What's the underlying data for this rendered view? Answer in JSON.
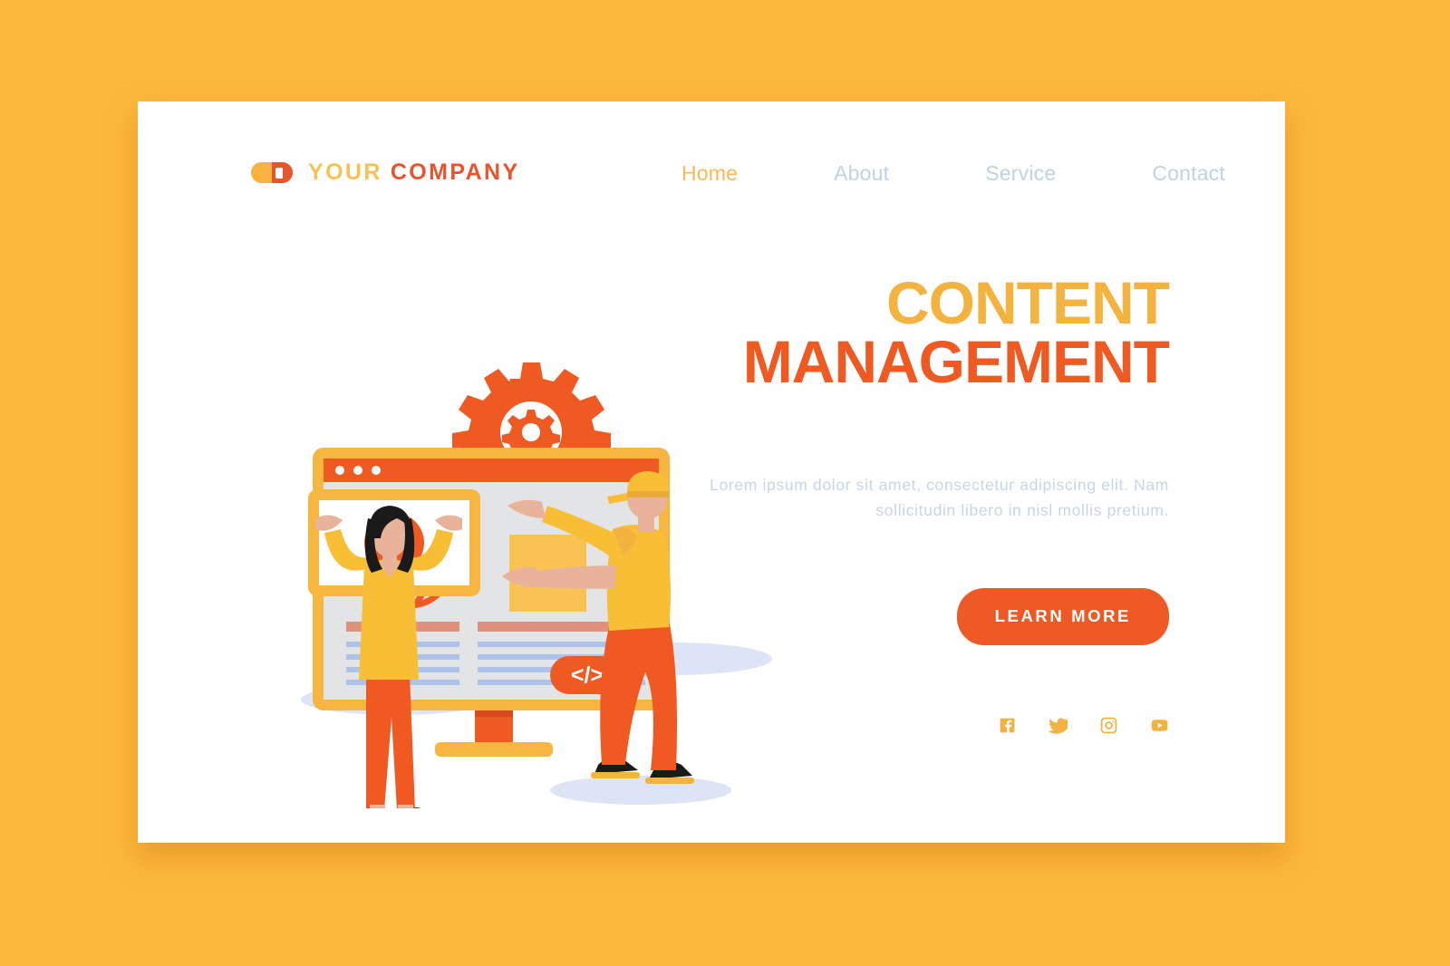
{
  "theme": {
    "background": "#FBB73C",
    "card": "#FFFFFF",
    "amber": "#F4B23F",
    "orange": "#EF5A22",
    "muted_blue": "#C5D7E3",
    "nav_inactive": "#BFD3E2",
    "nav_active": "#F3BB55",
    "coral": "#E0917D",
    "screen_grey": "#E3E4E6",
    "text_line_blue": "#AEC3E8",
    "shadow_lavender": "#DDE4F5",
    "skin": "#E8B29B",
    "hair_black": "#1A1A1A",
    "square_amber": "#F9C354"
  },
  "header": {
    "brand": {
      "mark_icon": "capsule-logo-icon",
      "word_one": "YOUR",
      "word_two": "COMPANY"
    },
    "nav": [
      {
        "label": "Home",
        "active": true
      },
      {
        "label": "About",
        "active": false
      },
      {
        "label": "Service",
        "active": false
      },
      {
        "label": "Contact",
        "active": false
      }
    ]
  },
  "hero": {
    "title_line_1": "CONTENT",
    "title_line_2": "MANAGEMENT",
    "paragraph": "Lorem ipsum dolor sit amet, consectetur adipiscing elit. Nam sollicitudin libero in nisl mollis pretium.",
    "cta_label": "LEARN MORE",
    "social": [
      {
        "name": "facebook-icon",
        "label": "Facebook"
      },
      {
        "name": "twitter-icon",
        "label": "Twitter"
      },
      {
        "name": "instagram-icon",
        "label": "Instagram"
      },
      {
        "name": "youtube-icon",
        "label": "YouTube"
      }
    ]
  },
  "illustration": {
    "name": "content-management-illustration",
    "elements": [
      "gear-icon",
      "browser-window-mockup",
      "browser-dots",
      "globe-icon",
      "amber-content-block",
      "video-player-card",
      "play-button-icon",
      "code-badge",
      "text-column-left",
      "text-column-right",
      "monitor-stand",
      "woman-character",
      "man-character"
    ],
    "code_badge_label": "</>"
  }
}
